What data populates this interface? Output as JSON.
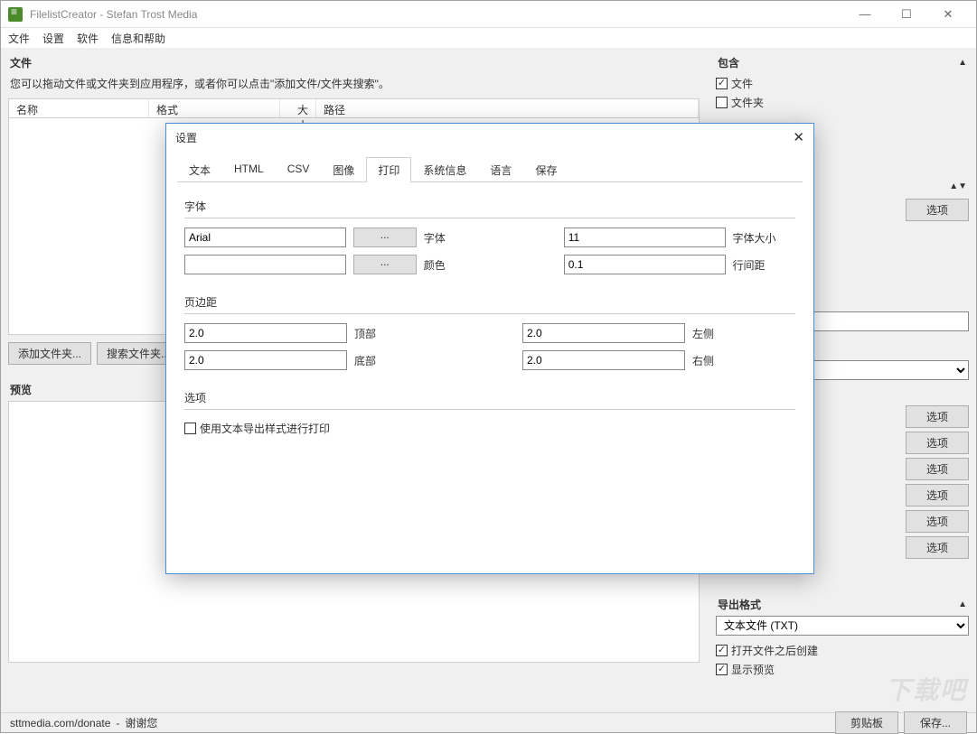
{
  "window": {
    "title": "FilelistCreator - Stefan Trost Media"
  },
  "menu": {
    "file": "文件",
    "settings": "设置",
    "software": "软件",
    "info": "信息和帮助"
  },
  "filesPanel": {
    "title": "文件",
    "help": "您可以拖动文件或文件夹到应用程序，或者你可以点击\"添加文件/文件夹搜索\"。",
    "col_name": "名称",
    "col_fmt": "格式",
    "col_size": "大小",
    "col_path": "路径",
    "btn_add": "添加文件夹...",
    "btn_search": "搜索文件夹..."
  },
  "includePanel": {
    "title": "包含",
    "files": "文件",
    "folders": "文件夹",
    "files_checked": true,
    "folders_checked": false
  },
  "rightButtons": {
    "opt": "选项"
  },
  "preview": {
    "title": "预览"
  },
  "exportFmt": {
    "title": "导出格式",
    "sel": "文本文件 (TXT)",
    "open_after": "打开文件之后创建",
    "open_after_checked": true,
    "show_preview": "显示预览",
    "show_preview_checked": true
  },
  "footer": {
    "url": "sttmedia.com/donate",
    "thx": "谢谢您",
    "clipboard": "剪贴板",
    "save": "保存..."
  },
  "dialog": {
    "title": "设置",
    "tabs": {
      "text": "文本",
      "html": "HTML",
      "csv": "CSV",
      "img": "图像",
      "print": "打印",
      "sys": "系统信息",
      "lang": "语言",
      "save": "保存"
    },
    "font": {
      "section": "字体",
      "font_val": "Arial",
      "font_lbl": "字体",
      "color_val": "#000000",
      "color_lbl": "颜色",
      "size_val": "11",
      "size_lbl": "字体大小",
      "line_val": "0.1",
      "line_lbl": "行间距"
    },
    "margin": {
      "section": "页边距",
      "top_v": "2.0",
      "top_l": "顶部",
      "bot_v": "2.0",
      "bot_l": "底部",
      "left_v": "2.0",
      "left_l": "左侧",
      "right_v": "2.0",
      "right_l": "右侧"
    },
    "opts": {
      "section": "选项",
      "use_text_style": "使用文本导出样式进行打印",
      "checked": false
    },
    "ellipsis": "..."
  }
}
